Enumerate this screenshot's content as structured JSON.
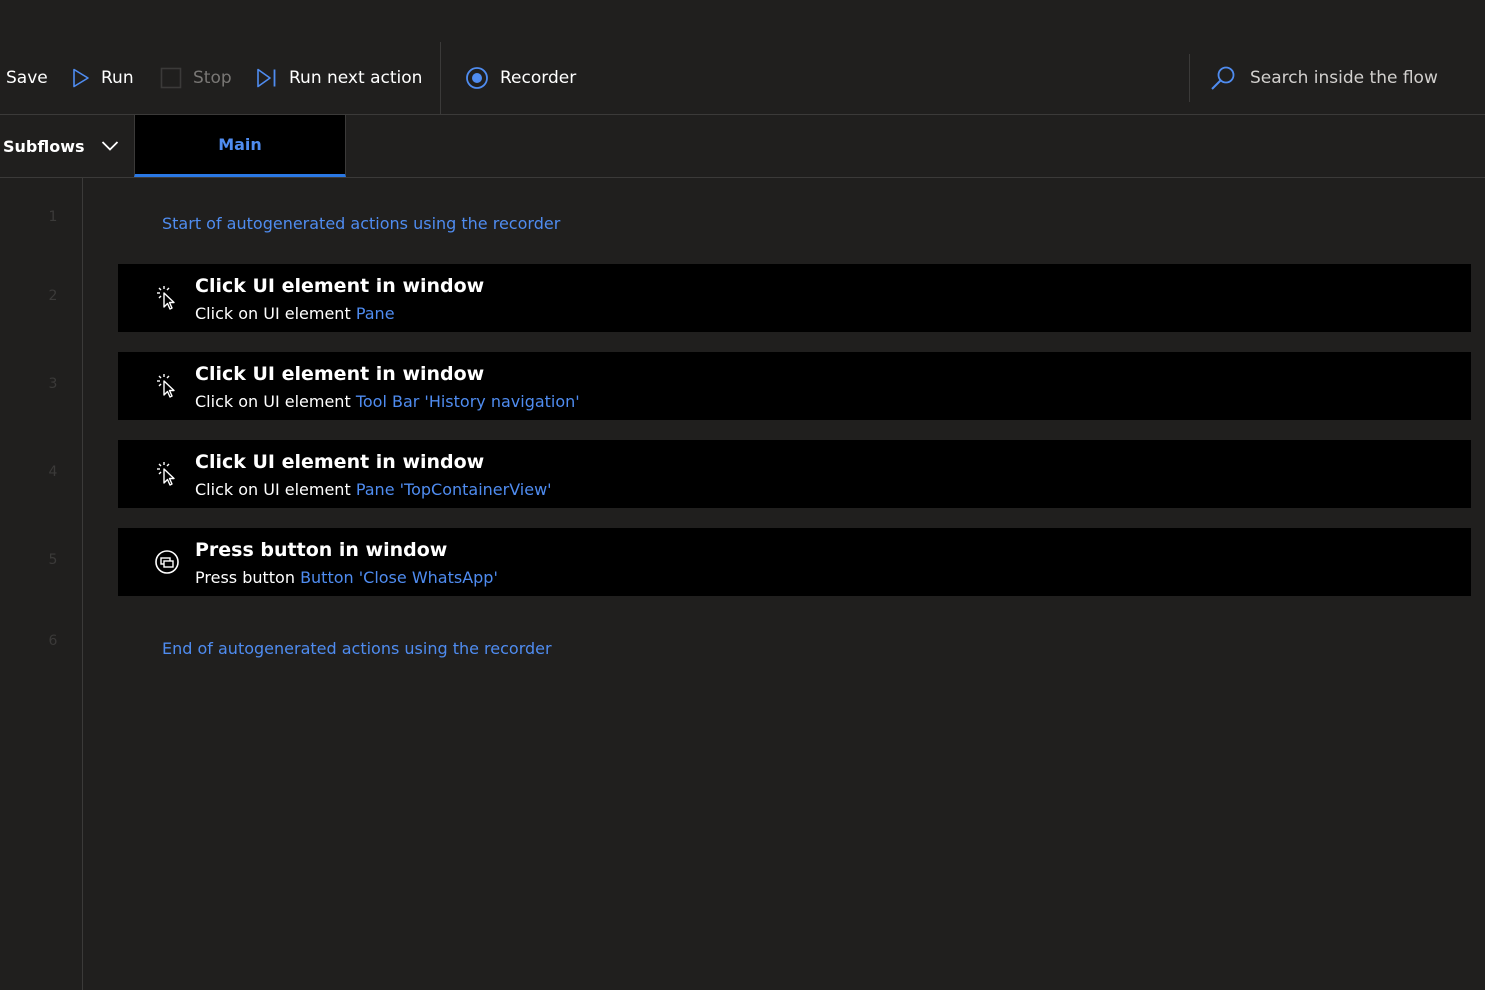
{
  "toolbar": {
    "save_label": "Save",
    "run_label": "Run",
    "stop_label": "Stop",
    "run_next_label": "Run next action",
    "recorder_label": "Recorder",
    "search_placeholder": "Search inside the flow"
  },
  "tabs": {
    "subflows_label": "Subflows",
    "main_label": "Main"
  },
  "flow": {
    "line_numbers": [
      "1",
      "2",
      "3",
      "4",
      "5",
      "6"
    ],
    "start_comment": "Start of autogenerated actions using the recorder",
    "end_comment": "End of autogenerated actions using the recorder",
    "actions": [
      {
        "icon": "click-ui-element-icon",
        "title": "Click UI element in window",
        "desc_prefix": "Click on UI element",
        "desc_link": "Pane"
      },
      {
        "icon": "click-ui-element-icon",
        "title": "Click UI element in window",
        "desc_prefix": "Click on UI element",
        "desc_link": "Tool Bar 'History navigation'"
      },
      {
        "icon": "click-ui-element-icon",
        "title": "Click UI element in window",
        "desc_prefix": "Click on UI element",
        "desc_link": "Pane 'TopContainerView'"
      },
      {
        "icon": "press-button-icon",
        "title": "Press button in window",
        "desc_prefix": "Press button",
        "desc_link": "Button 'Close WhatsApp'"
      }
    ]
  },
  "colors": {
    "background": "#201f1e",
    "accent": "#2a78e4",
    "link": "#4f8cf0",
    "action_bg": "#000000"
  }
}
